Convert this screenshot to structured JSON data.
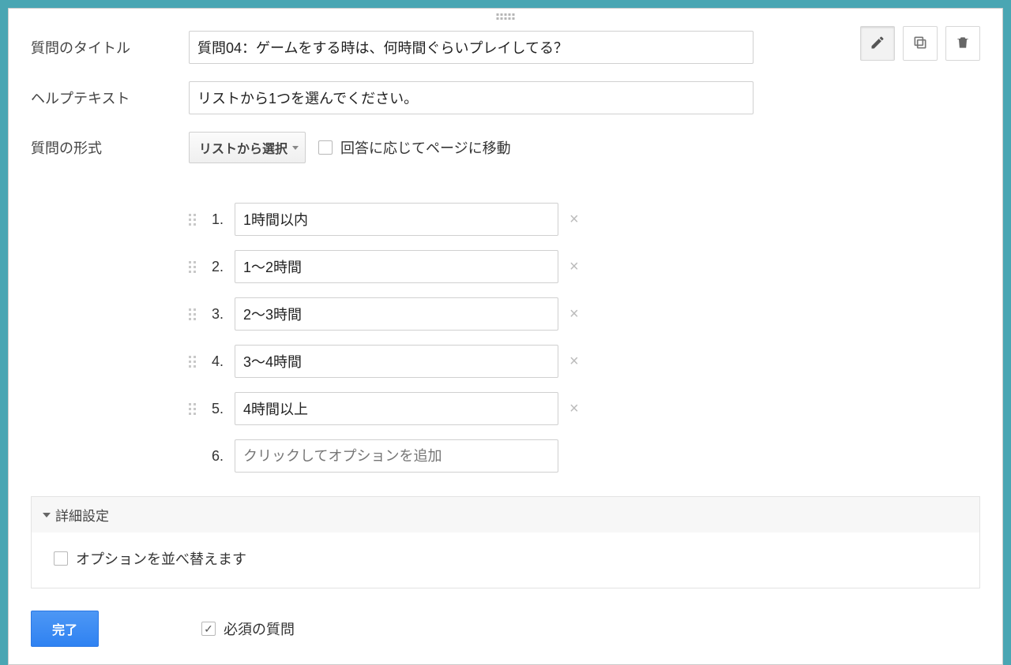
{
  "labels": {
    "title": "質問のタイトル",
    "help": "ヘルプテキスト",
    "type": "質問の形式"
  },
  "fields": {
    "title_value": "質問04：ゲームをする時は、何時間ぐらいプレイしてる？",
    "help_value": "リストから1つを選んでください。",
    "type_dropdown": "リストから選択",
    "goto_label": "回答に応じてページに移動"
  },
  "options": [
    {
      "num": "1.",
      "value": "1時間以内"
    },
    {
      "num": "2.",
      "value": "1〜2時間"
    },
    {
      "num": "3.",
      "value": "2〜3時間"
    },
    {
      "num": "4.",
      "value": "3〜4時間"
    },
    {
      "num": "5.",
      "value": "4時間以上"
    }
  ],
  "add_option": {
    "num": "6.",
    "placeholder": "クリックしてオプションを追加"
  },
  "advanced": {
    "header": "詳細設定",
    "shuffle": "オプションを並べ替えます"
  },
  "footer": {
    "done": "完了",
    "required": "必須の質問"
  }
}
